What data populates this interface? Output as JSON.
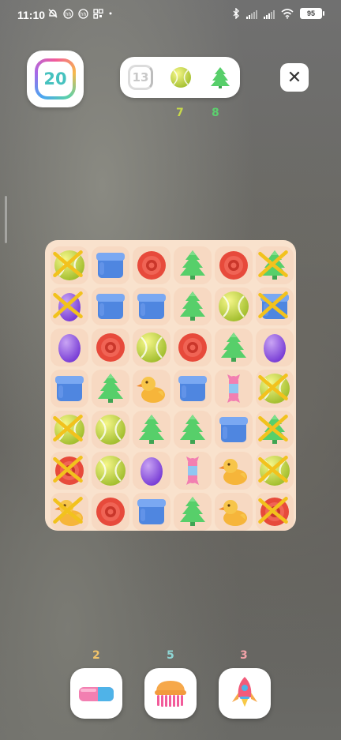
{
  "status_bar": {
    "time": "11:10",
    "battery": "95"
  },
  "level": {
    "number": "20"
  },
  "goals": {
    "moves": "13",
    "items": [
      {
        "icon": "ball-icon",
        "count": "7",
        "color": "#c8d94a"
      },
      {
        "icon": "tree-icon",
        "count": "8",
        "color": "#5ccf6e"
      }
    ]
  },
  "close_label": "✕",
  "board": {
    "columns": 6,
    "rows": 7,
    "cells": [
      {
        "row": 0,
        "col": 0,
        "type": "ball",
        "cleared": true
      },
      {
        "row": 0,
        "col": 1,
        "type": "box",
        "cleared": false
      },
      {
        "row": 0,
        "col": 2,
        "type": "donut",
        "cleared": false
      },
      {
        "row": 0,
        "col": 3,
        "type": "tree",
        "cleared": false
      },
      {
        "row": 0,
        "col": 4,
        "type": "donut",
        "cleared": false
      },
      {
        "row": 0,
        "col": 5,
        "type": "tree",
        "cleared": true
      },
      {
        "row": 1,
        "col": 0,
        "type": "egg",
        "cleared": true
      },
      {
        "row": 1,
        "col": 1,
        "type": "box",
        "cleared": false
      },
      {
        "row": 1,
        "col": 2,
        "type": "box",
        "cleared": false
      },
      {
        "row": 1,
        "col": 3,
        "type": "tree",
        "cleared": false
      },
      {
        "row": 1,
        "col": 4,
        "type": "ball",
        "cleared": false
      },
      {
        "row": 1,
        "col": 5,
        "type": "box",
        "cleared": true
      },
      {
        "row": 2,
        "col": 0,
        "type": "egg",
        "cleared": false
      },
      {
        "row": 2,
        "col": 1,
        "type": "donut",
        "cleared": false
      },
      {
        "row": 2,
        "col": 2,
        "type": "ball",
        "cleared": false
      },
      {
        "row": 2,
        "col": 3,
        "type": "donut",
        "cleared": false
      },
      {
        "row": 2,
        "col": 4,
        "type": "tree",
        "cleared": false
      },
      {
        "row": 2,
        "col": 5,
        "type": "egg",
        "cleared": false
      },
      {
        "row": 3,
        "col": 0,
        "type": "box",
        "cleared": false
      },
      {
        "row": 3,
        "col": 1,
        "type": "tree",
        "cleared": false
      },
      {
        "row": 3,
        "col": 2,
        "type": "duck",
        "cleared": false
      },
      {
        "row": 3,
        "col": 3,
        "type": "box",
        "cleared": false
      },
      {
        "row": 3,
        "col": 4,
        "type": "candy",
        "cleared": false
      },
      {
        "row": 3,
        "col": 5,
        "type": "ball",
        "cleared": true
      },
      {
        "row": 4,
        "col": 0,
        "type": "ball",
        "cleared": true
      },
      {
        "row": 4,
        "col": 1,
        "type": "ball",
        "cleared": false
      },
      {
        "row": 4,
        "col": 2,
        "type": "tree",
        "cleared": false
      },
      {
        "row": 4,
        "col": 3,
        "type": "tree",
        "cleared": false
      },
      {
        "row": 4,
        "col": 4,
        "type": "box",
        "cleared": false
      },
      {
        "row": 4,
        "col": 5,
        "type": "tree",
        "cleared": true
      },
      {
        "row": 5,
        "col": 0,
        "type": "donut",
        "cleared": true
      },
      {
        "row": 5,
        "col": 1,
        "type": "ball",
        "cleared": false
      },
      {
        "row": 5,
        "col": 2,
        "type": "egg",
        "cleared": false
      },
      {
        "row": 5,
        "col": 3,
        "type": "candy",
        "cleared": false
      },
      {
        "row": 5,
        "col": 4,
        "type": "duck",
        "cleared": false
      },
      {
        "row": 5,
        "col": 5,
        "type": "ball",
        "cleared": true
      },
      {
        "row": 6,
        "col": 0,
        "type": "duck",
        "cleared": true
      },
      {
        "row": 6,
        "col": 1,
        "type": "donut",
        "cleared": false
      },
      {
        "row": 6,
        "col": 2,
        "type": "box",
        "cleared": false
      },
      {
        "row": 6,
        "col": 3,
        "type": "tree",
        "cleared": false
      },
      {
        "row": 6,
        "col": 4,
        "type": "duck",
        "cleared": false
      },
      {
        "row": 6,
        "col": 5,
        "type": "donut",
        "cleared": true
      }
    ]
  },
  "boosters": [
    {
      "name": "eraser",
      "count": "2",
      "color": "#f2c46a"
    },
    {
      "name": "brush",
      "count": "5",
      "color": "#8fd6d4"
    },
    {
      "name": "rocket",
      "count": "3",
      "color": "#f2a2a8"
    }
  ]
}
